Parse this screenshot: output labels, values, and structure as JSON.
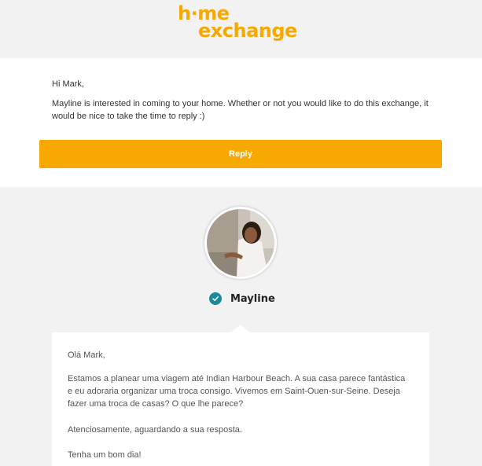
{
  "brand": {
    "logo_line1": "h·me",
    "logo_line2": "exchange",
    "color": "#f7a900"
  },
  "notice": {
    "greeting": "Hi Mark,",
    "body": "Mayline is interested in coming to your home. Whether or not you would like to do this exchange, it would be nice to take the time to reply :)",
    "reply_label": "Reply"
  },
  "sender": {
    "name": "Mayline",
    "avatar": "profile-photo",
    "verified_icon": "check-badge-icon",
    "verified_color": "#1a8a9b"
  },
  "message": {
    "salutation": "Olá Mark,",
    "paragraph": "Estamos a planear uma viagem até Indian Harbour Beach. A sua casa parece fantástica e eu adoraria organizar uma troca consigo. Vivemos em Saint-Ouen-sur-Seine. Deseja fazer uma troca de casas? O que lhe parece?",
    "closing": "Atenciosamente, aguardando a sua resposta.",
    "signoff": "Tenha um bom dia!"
  }
}
